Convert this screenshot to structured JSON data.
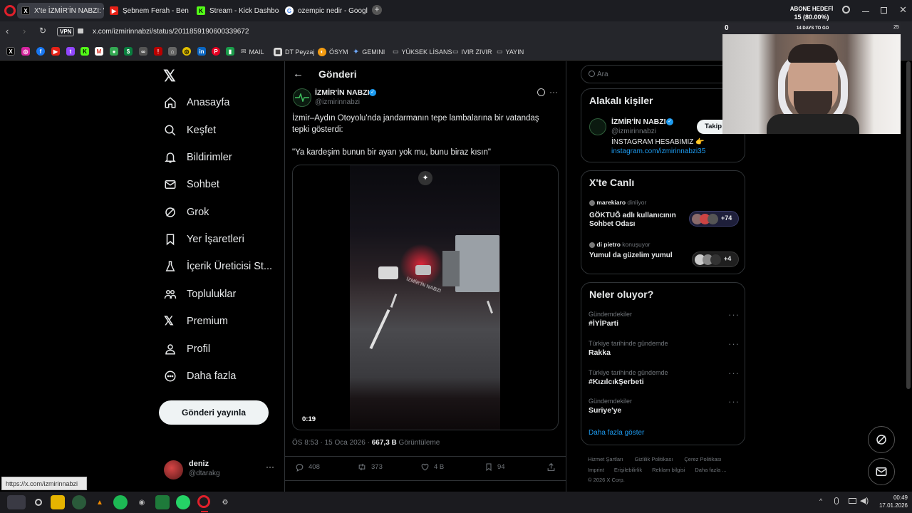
{
  "browser": {
    "tabs": [
      {
        "label": "X'te İZMİR'İN NABZI: \"İzm"
      },
      {
        "label": "Şebnem Ferah - Ben Şarkı"
      },
      {
        "label": "Stream - Kick Dashboard"
      },
      {
        "label": "ozempic nedir - Google'da"
      }
    ],
    "vpn": "VPN",
    "url": "x.com/izmirinnabzi/status/2011859190600339672",
    "bookmarks": [
      "MAIL",
      "DT Peyzaj",
      "ÖSYM",
      "GEMINI",
      "YÜKSEK LİSANS",
      "IVIR ZIVIR",
      "YAYIN"
    ]
  },
  "overlay": {
    "sub_goal": "ABONE HEDEFİ",
    "sub_progress": "15 (80.00%)",
    "days_to_go": "14 DAYS TO GO",
    "counter": "0",
    "badge": "25"
  },
  "nav": {
    "items": [
      "Anasayfa",
      "Keşfet",
      "Bildirimler",
      "Sohbet",
      "Grok",
      "Yer İşaretleri",
      "İçerik Üreticisi St...",
      "Topluluklar",
      "Premium",
      "Profil",
      "Daha fazla"
    ],
    "post_button": "Gönderi yayınla",
    "user_name": "deniz",
    "user_handle": "@dtarakg"
  },
  "post": {
    "header_title": "Gönderi",
    "author_name": "İZMİR'İN NABZI",
    "author_handle": "@izmirinnabzi",
    "text_line1": "İzmir–Aydın Otoyolu'nda jandarmanın tepe lambalarına bir vatandaş",
    "text_line2": "tepki gösterdi:",
    "quote": "\"Ya kardeşim bunun bir ayarı yok mu, bunu biraz kısın\"",
    "video_time": "0:19",
    "watermark": "İZMİR'İN NABZI",
    "meta_time": "ÖS 8:53 · 15 Oca 2026 ·",
    "views_count": "667,3 B",
    "views_label": "Görüntüleme",
    "replies": "408",
    "reposts": "373",
    "likes": "4 B",
    "bookmarks": "94"
  },
  "search": {
    "placeholder": "Ara"
  },
  "people": {
    "title": "Alakalı kişiler",
    "name": "İZMİR'İN NABZI",
    "handle": "@izmirinnabzi",
    "follow": "Takip",
    "bio": "İNSTAGRAM HESABIMIZ 👉",
    "link": "instagram.com/izmirinnabzi35"
  },
  "live": {
    "title": "X'te Canlı",
    "items": [
      {
        "host": "marekiaro",
        "status": "dinliyor",
        "title1": "GÖKTUĞ adlı kullanıcının",
        "title2": "Sohbet Odası",
        "count": "+74"
      },
      {
        "host": "di pietro",
        "status": "konuşuyor",
        "title1": "Yumul da güzelim yumul",
        "title2": "",
        "count": "+4"
      }
    ]
  },
  "trends": {
    "title": "Neler oluyor?",
    "items": [
      {
        "context": "Gündemdekiler",
        "name": "#İYİParti"
      },
      {
        "context": "Türkiye tarihinde gündemde",
        "name": "Rakka"
      },
      {
        "context": "Türkiye tarihinde gündemde",
        "name": "#KızılcıkŞerbeti"
      },
      {
        "context": "Gündemdekiler",
        "name": "Suriye'ye"
      }
    ],
    "show_more": "Daha fazla göster"
  },
  "footer": {
    "links1": [
      "Hizmet Şartları",
      "Gizlilik Politikası",
      "Çerez Politikası"
    ],
    "links2": [
      "Imprint",
      "Erişilebilirlik",
      "Reklam bilgisi",
      "Daha fazla ..."
    ],
    "copyright": "© 2026 X Corp."
  },
  "status_url": "https://x.com/izmirinnabzi",
  "taskbar": {
    "time": "00:49",
    "date": "17.01.2026"
  },
  "colors": {
    "accent": "#1d9bf0",
    "verified": "#1d9bf0",
    "bg": "#000000",
    "border": "#2f3336"
  }
}
